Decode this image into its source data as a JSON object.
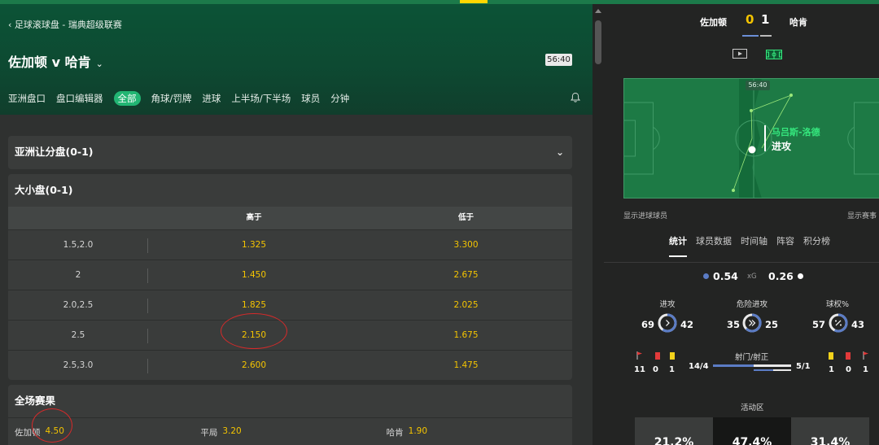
{
  "breadcrumb": "足球滚球盘 - 瑞典超级联赛",
  "match_title": "佐加顿 v 哈肯",
  "clock": "56:40",
  "tabs": [
    {
      "label": "亚洲盘口"
    },
    {
      "label": "盘口编辑器"
    },
    {
      "label": "全部",
      "active": true
    },
    {
      "label": "角球/罚牌"
    },
    {
      "label": "进球"
    },
    {
      "label": "上半场/下半场"
    },
    {
      "label": "球员"
    },
    {
      "label": "分钟"
    }
  ],
  "asian_handicap": {
    "title": "亚洲让分盘(0-1)"
  },
  "over_under": {
    "title": "大小盘(0-1)",
    "col_over": "高于",
    "col_under": "低于",
    "rows": [
      {
        "line": "1.5,2.0",
        "over": "1.325",
        "under": "3.300"
      },
      {
        "line": "2",
        "over": "1.450",
        "under": "2.675"
      },
      {
        "line": "2.0,2.5",
        "over": "1.825",
        "under": "2.025"
      },
      {
        "line": "2.5",
        "over": "2.150",
        "under": "1.675"
      },
      {
        "line": "2.5,3.0",
        "over": "2.600",
        "under": "1.475"
      }
    ]
  },
  "full_time": {
    "title": "全场赛果",
    "items": [
      {
        "name": "佐加顿",
        "odds": "4.50"
      },
      {
        "name": "平局",
        "odds": "3.20"
      },
      {
        "name": "哈肯",
        "odds": "1.90"
      }
    ]
  },
  "scoreboard": {
    "home": "佐加顿",
    "home_score": "0",
    "away_score": "1",
    "away": "哈肯"
  },
  "pitch": {
    "time": "56:40",
    "player": "马吕斯-洛德",
    "action": "进攻",
    "show_goal_scorers": "显示进球球员",
    "show_events": "显示赛事"
  },
  "stats_tabs": [
    {
      "label": "统计",
      "active": true
    },
    {
      "label": "球员数据"
    },
    {
      "label": "时间轴"
    },
    {
      "label": "阵容"
    },
    {
      "label": "积分榜"
    }
  ],
  "xg": {
    "home": "0.54",
    "label": "xG",
    "away": "0.26"
  },
  "stats": [
    {
      "label": "进攻",
      "home": "69",
      "away": "42",
      "icon": "chevron-icon"
    },
    {
      "label": "危险进攻",
      "home": "35",
      "away": "25",
      "icon": "double-chevron-icon"
    },
    {
      "label": "球权%",
      "home": "57",
      "away": "43",
      "icon": "percent-icon"
    }
  ],
  "cards": {
    "home": {
      "corners": "11",
      "red": "0",
      "yellow": "1"
    },
    "away": {
      "yellow": "1",
      "red": "0",
      "corners": "1"
    }
  },
  "shots": {
    "label": "射门/射正",
    "home": "14/4",
    "away": "5/1"
  },
  "activity": {
    "label": "活动区",
    "zones": [
      "21.2%",
      "47.4%",
      "31.4%"
    ]
  },
  "colors": {
    "accent": "#22b573",
    "odds": "#f4c400",
    "home": "#5b7cc5",
    "away": "#e9e9e9",
    "pitch": "#1d7a45",
    "annotation": "#d62a2a"
  }
}
